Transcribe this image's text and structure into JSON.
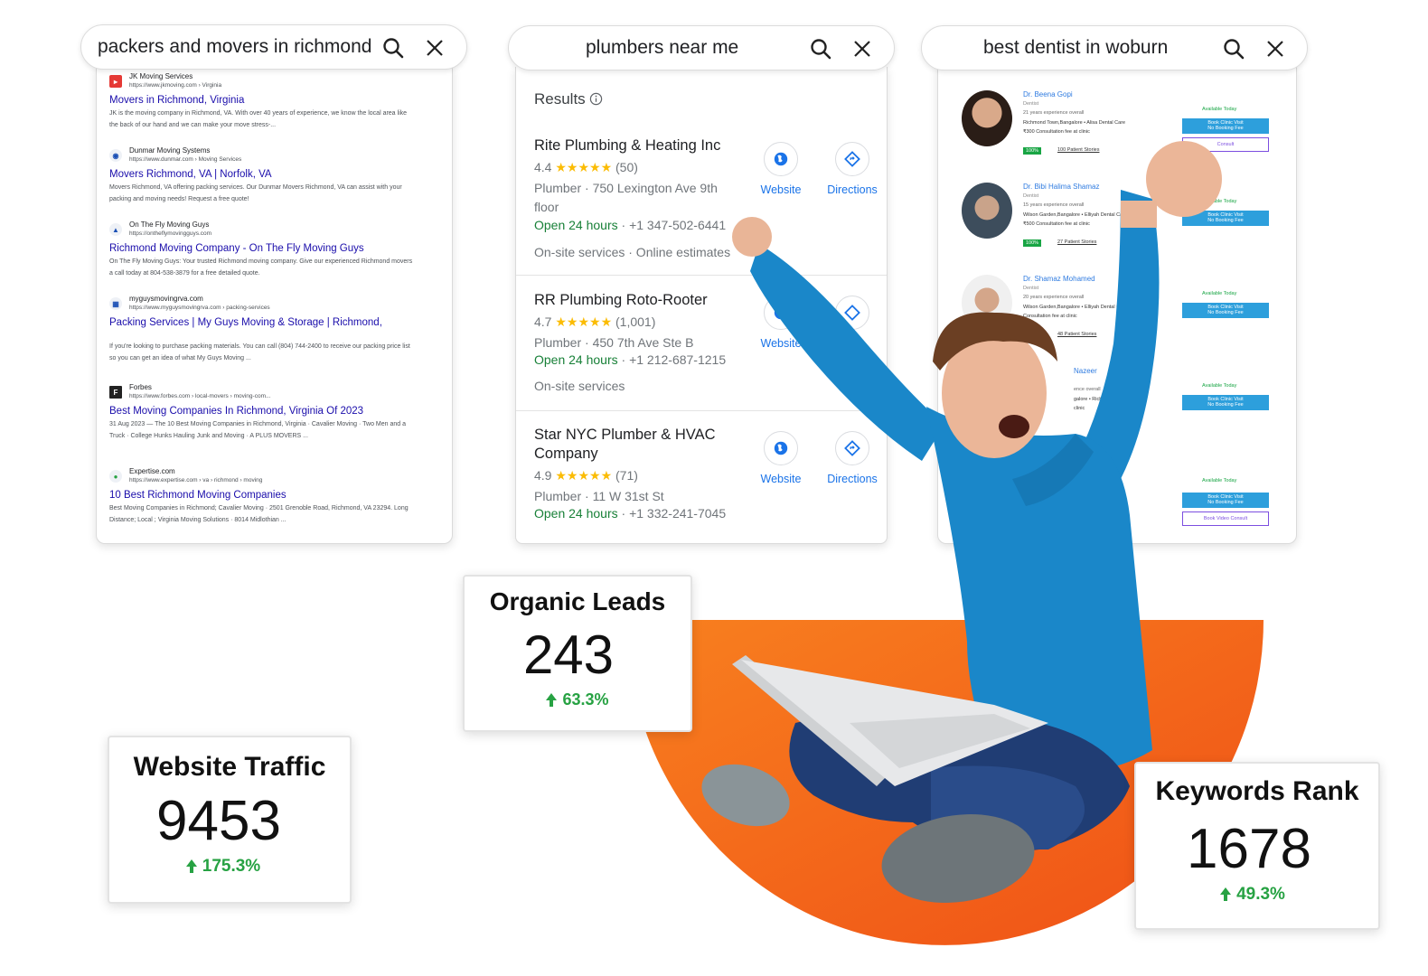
{
  "searches": [
    {
      "query": "packers and movers in richmond"
    },
    {
      "query": "plumbers near me"
    },
    {
      "query": "best dentist in woburn"
    }
  ],
  "organic_results": [
    {
      "site": "JK Moving Services",
      "url": "https://www.jkmoving.com › Virginia",
      "title": "Movers in Richmond, Virginia",
      "snippet": "JK is the moving company in Richmond, VA. With over 40 years of experience, we know the local area like the back of our hand and we can make your move stress-..."
    },
    {
      "site": "Dunmar Moving Systems",
      "url": "https://www.dunmar.com › Moving Services",
      "title": "Movers Richmond, VA | Norfolk, VA",
      "snippet": "Movers Richmond, VA offering packing services. Our Dunmar Movers Richmond, VA can assist with your packing and moving needs! Request a free quote!"
    },
    {
      "site": "On The Fly Moving Guys",
      "url": "https://ontheflymovingguys.com",
      "title": "Richmond Moving Company - On The Fly Moving Guys",
      "snippet": "On The Fly Moving Guys: Your trusted Richmond moving company. Give our experienced Richmond movers a call today at 804-538-3879 for a free detailed quote."
    },
    {
      "site": "myguysmovingrva.com",
      "url": "https://www.myguysmovingrva.com › packing-services",
      "title": "Packing Services | My Guys Moving & Storage | Richmond,",
      "snippet": "If you're looking to purchase packing materials. You can call (804) 744-2400 to receive our packing price list so you can get an idea of what My Guys Moving ..."
    },
    {
      "site": "Forbes",
      "url": "https://www.forbes.com › local-movers › moving-com...",
      "title": "Best Moving Companies In Richmond, Virginia Of 2023",
      "snippet": "31 Aug 2023 — The 10 Best Moving Companies in Richmond, Virginia · Cavalier Moving · Two Men and a Truck · College Hunks Hauling Junk and Moving · A PLUS MOVERS ..."
    },
    {
      "site": "Expertise.com",
      "url": "https://www.expertise.com › va › richmond › moving",
      "title": "10 Best Richmond Moving Companies",
      "snippet": "Best Moving Companies in Richmond; Cavalier Moving · 2501 Grenoble Road, Richmond, VA 23294. Long Distance; Local ; Virginia Moving Solutions · 8014 Midlothian ..."
    }
  ],
  "local_results": {
    "header": "Results",
    "items": [
      {
        "name": "Rite Plumbing & Heating Inc",
        "rating": "4.4",
        "stars": "★★★★★",
        "reviews": "(50)",
        "address": "Plumber · 750 Lexington Ave 9th floor",
        "open": "Open 24 hours",
        "phone": " · +1 347-502-6441",
        "extra": "On-site services · Online estimates"
      },
      {
        "name": "RR Plumbing Roto-Rooter",
        "rating": "4.7",
        "stars": "★★★★★",
        "reviews": "(1,001)",
        "address": "Plumber · 450 7th Ave Ste B",
        "open": "Open 24 hours",
        "phone": " · +1 212-687-1215",
        "extra": "On-site services"
      },
      {
        "name": "Star NYC Plumber & HVAC Company",
        "rating": "4.9",
        "stars": "★★★★★",
        "reviews": "(71)",
        "address": "Plumber · 11 W 31st St",
        "open": "Open 24 hours",
        "phone": " · +1 332-241-7045",
        "extra": ""
      }
    ],
    "website_label": "Website",
    "directions_label": "Directions"
  },
  "dentists": [
    {
      "name": "Dr. Beena Gopi",
      "specialty": "Dentist",
      "experience": "21 years experience overall",
      "location": "Richmond Town,Bangalore • Alisa Dental Care",
      "fee": "₹300 Consultation fee at clinic",
      "pct": "100%",
      "stories": "100 Patient Stories",
      "available": "Available Today",
      "book": "Book Clinic Visit",
      "book_sub": "No Booking Fee",
      "video": "Consult"
    },
    {
      "name": "Dr. Bibi Halima Shamaz",
      "specialty": "Dentist",
      "experience": "15 years experience overall",
      "location": "Wilson Garden,Bangalore • Elliyah Dental Care",
      "fee": "₹500 Consultation fee at clinic",
      "pct": "100%",
      "stories": "27 Patient Stories",
      "available": "Available Today",
      "book": "Book Clinic Visit",
      "book_sub": "No Booking Fee",
      "video": ""
    },
    {
      "name": "Dr. Shamaz Mohamed",
      "specialty": "Dentist",
      "experience": "20 years experience overall",
      "location": "Wilson Garden,Bangalore • Elliyah Dental Care",
      "fee": "Consultation fee at clinic",
      "pct": "100%",
      "stories": "48 Patient Stories",
      "available": "Available Today",
      "book": "Book Clinic Visit",
      "book_sub": "No Booking Fee",
      "video": ""
    },
    {
      "name": "Nazeer",
      "specialty": "",
      "experience": "ence overall",
      "location": "galore • Richmond Dent",
      "fee": "clinic",
      "pct": "",
      "stories": "",
      "available": "Available Today",
      "book": "Book Clinic Visit",
      "book_sub": "No Booking Fee",
      "video": ""
    },
    {
      "name": "",
      "specialty": "",
      "experience": "",
      "location": "",
      "fee": "",
      "pct": "",
      "stories": "",
      "available": "Available Today",
      "book": "Book Clinic Visit",
      "book_sub": "No Booking Fee",
      "video": "Book Video Consult"
    }
  ],
  "stats": {
    "organic_leads": {
      "title": "Organic Leads",
      "value": "243",
      "delta": "63.3%"
    },
    "website_traffic": {
      "title": "Website Traffic",
      "value": "9453",
      "delta": "175.3%"
    },
    "keywords_rank": {
      "title": "Keywords Rank",
      "value": "1678",
      "delta": "49.3%"
    }
  },
  "colors": {
    "accent_orange": "#f2611c",
    "link_blue": "#1a0dab",
    "maps_blue": "#1a73e8",
    "open_green": "#188038",
    "delta_green": "#27a243",
    "shirt_blue": "#1a87c9"
  },
  "icons": [
    "search-icon",
    "close-icon",
    "globe-icon",
    "directions-icon",
    "info-icon",
    "up-arrow-icon"
  ]
}
